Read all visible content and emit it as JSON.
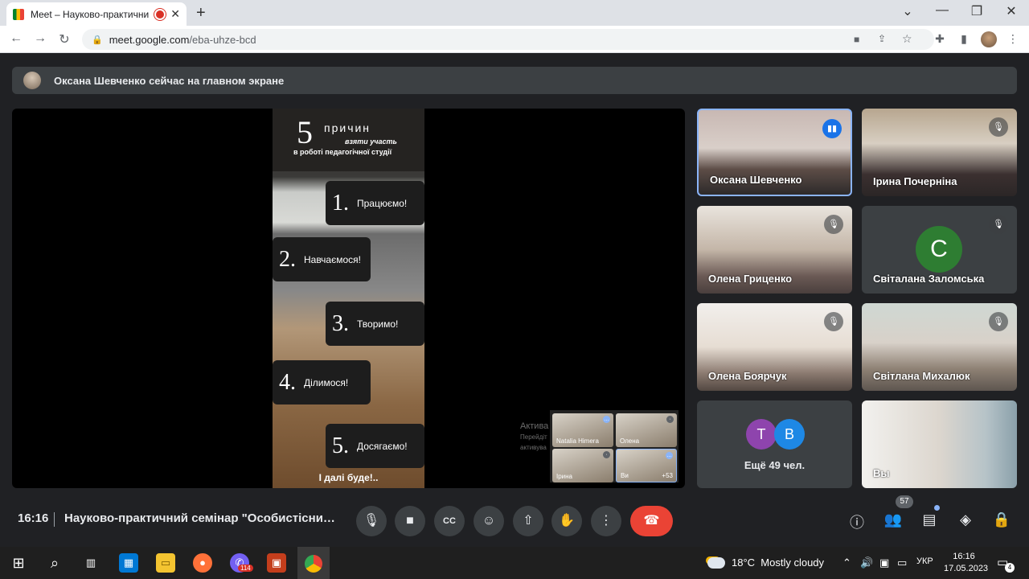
{
  "browser": {
    "tab_title": "Meet – Науково-практични",
    "tab_close": "✕",
    "new_tab": "+",
    "url_host": "meet.google.com",
    "url_path": "/eba-uhze-bcd"
  },
  "banner": {
    "text": "Оксана Шевченко сейчас на главном экране"
  },
  "slide": {
    "big_number": "5",
    "title": "причин",
    "subtitle_1": "взяти участь",
    "subtitle_2": "в роботі педагогічної студії",
    "items": [
      {
        "num": "1.",
        "text": "Працюємо!"
      },
      {
        "num": "2.",
        "text": "Навчаємося!"
      },
      {
        "num": "3.",
        "text": "Творимо!"
      },
      {
        "num": "4.",
        "text": "Ділимося!"
      },
      {
        "num": "5.",
        "text": "Досягаємо!"
      }
    ],
    "footer": "І далі буде!.."
  },
  "stage_mini": {
    "labels": [
      "Natalia Himera",
      "Олена",
      "Ірина",
      "Ви"
    ],
    "more": "+53"
  },
  "watermark": {
    "line1": "Актива",
    "line2": "Перейдіт",
    "line3": "активува"
  },
  "participants": [
    {
      "name": "Оксана Шевченко",
      "speaking": true
    },
    {
      "name": "Ірина Почерніна",
      "muted": true
    },
    {
      "name": "Олена Гриценко",
      "muted": true
    },
    {
      "name": "Світалана Заломська",
      "muted": true,
      "avatar_letter": "С",
      "avatar_color": "#2e7d32"
    },
    {
      "name": "Олена Боярчук",
      "muted": true
    },
    {
      "name": "Світлана Михалюк",
      "muted": true
    },
    {
      "name": "Вы"
    }
  ],
  "more_tile": {
    "letters": [
      "Т",
      "В"
    ],
    "colors": [
      "#8e44ad",
      "#1e88e5"
    ],
    "text": "Ещё 49 чел."
  },
  "bottom": {
    "time": "16:16",
    "meeting_name": "Науково-практичний семінар \"Особистісний...",
    "people_count": "57"
  },
  "taskbar": {
    "viber_badge": "114",
    "weather_temp": "18°C",
    "weather_text": "Mostly cloudy",
    "lang": "УКР",
    "time": "16:16",
    "date": "17.05.2023",
    "notifications": "4"
  },
  "colors": {
    "accent": "#8ab4f8",
    "end_call": "#ea4335",
    "bg": "#202124"
  }
}
